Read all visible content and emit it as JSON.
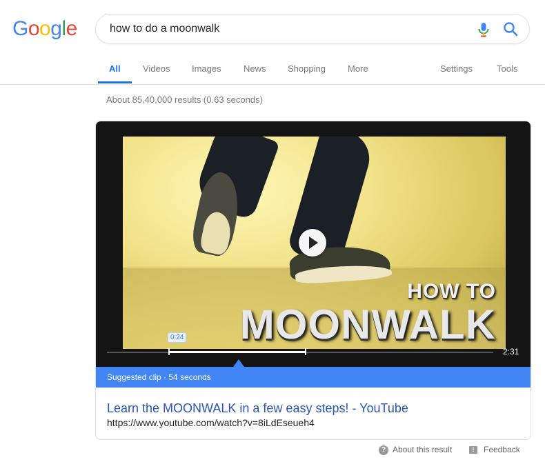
{
  "logo": {
    "letters": [
      "G",
      "o",
      "o",
      "g",
      "l",
      "e"
    ],
    "colors": [
      "#4285f4",
      "#ea4335",
      "#fbbc05",
      "#4285f4",
      "#34a853",
      "#ea4335"
    ]
  },
  "search": {
    "query": "how to do a moonwalk"
  },
  "tabs": [
    {
      "label": "All"
    },
    {
      "label": "Videos"
    },
    {
      "label": "Images"
    },
    {
      "label": "News"
    },
    {
      "label": "Shopping"
    },
    {
      "label": "More"
    },
    {
      "label": "Settings"
    },
    {
      "label": "Tools"
    }
  ],
  "stats": "About 85,40,000 results (0.63 seconds)",
  "video": {
    "overlay_line1": "HOW TO",
    "overlay_line2": "MOONWALK",
    "clip_start": "0:24",
    "duration": "2:31",
    "suggested_clip": "Suggested clip · 54 seconds"
  },
  "result": {
    "title": "Learn the MOONWALK in a few easy steps! - YouTube",
    "url": "https://www.youtube.com/watch?v=8iLdEseueh4"
  },
  "footer": {
    "about": "About this result",
    "feedback": "Feedback"
  },
  "colors": {
    "accent": "#4285f4",
    "active_tab": "#1a73e8",
    "link": "#2a55b8"
  }
}
